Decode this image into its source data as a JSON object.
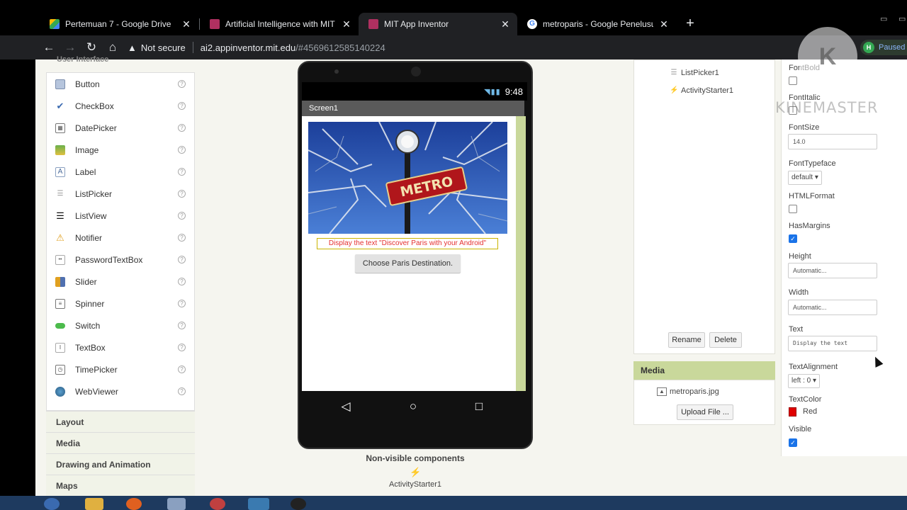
{
  "browser": {
    "tabs": [
      {
        "title": "Pertemuan 7 - Google Drive",
        "icon": "google-drive-icon",
        "active": false
      },
      {
        "title": "Artificial Intelligence with MIT Ap",
        "icon": "mit-app-inventor-icon",
        "active": false
      },
      {
        "title": "MIT App Inventor",
        "icon": "mit-app-inventor-icon",
        "active": true
      },
      {
        "title": "metroparis - Google Penelusuran",
        "icon": "google-icon",
        "active": false
      }
    ],
    "security_label": "Not secure",
    "url_host": "ai2.appinventor.mit.edu",
    "url_path": "/#4569612585140224",
    "profile_initial": "H",
    "profile_status": "Paused"
  },
  "palette": {
    "section_title": "User Interface",
    "items": [
      {
        "label": "Button",
        "icon": "button-icon"
      },
      {
        "label": "CheckBox",
        "icon": "checkbox-icon"
      },
      {
        "label": "DatePicker",
        "icon": "datepicker-icon"
      },
      {
        "label": "Image",
        "icon": "image-icon"
      },
      {
        "label": "Label",
        "icon": "label-icon"
      },
      {
        "label": "ListPicker",
        "icon": "listpicker-icon"
      },
      {
        "label": "ListView",
        "icon": "listview-icon"
      },
      {
        "label": "Notifier",
        "icon": "notifier-icon"
      },
      {
        "label": "PasswordTextBox",
        "icon": "password-icon"
      },
      {
        "label": "Slider",
        "icon": "slider-icon"
      },
      {
        "label": "Spinner",
        "icon": "spinner-icon"
      },
      {
        "label": "Switch",
        "icon": "switch-icon"
      },
      {
        "label": "TextBox",
        "icon": "textbox-icon"
      },
      {
        "label": "TimePicker",
        "icon": "timepicker-icon"
      },
      {
        "label": "WebViewer",
        "icon": "webviewer-icon"
      }
    ],
    "help_glyph": "?",
    "categories": [
      "Layout",
      "Media",
      "Drawing and Animation",
      "Maps"
    ]
  },
  "viewer": {
    "time": "9:48",
    "screen_title": "Screen1",
    "image_text": "METRO",
    "label_text": "Display the text \"Discover Paris with your Android\"",
    "button_text": "Choose Paris Destination.",
    "nonvisible_title": "Non-visible components",
    "nonvisible_item": "ActivityStarter1"
  },
  "components": {
    "items": [
      "ListPicker1",
      "ActivityStarter1"
    ],
    "rename_label": "Rename",
    "delete_label": "Delete"
  },
  "media": {
    "title": "Media",
    "file": "metroparis.jpg",
    "upload_label": "Upload File ..."
  },
  "properties": {
    "fontbold_label": "FontBold",
    "fontitalic_label": "FontItalic",
    "fontsize_label": "FontSize",
    "fontsize_value": "14.0",
    "fonttypeface_label": "FontTypeface",
    "fonttypeface_value": "default",
    "htmlformat_label": "HTMLFormat",
    "hasmargins_label": "HasMargins",
    "height_label": "Height",
    "height_value": "Automatic...",
    "width_label": "Width",
    "width_value": "Automatic...",
    "text_label": "Text",
    "text_value": "Display the text",
    "textalignment_label": "TextAlignment",
    "textalignment_value": "left : 0",
    "textcolor_label": "TextColor",
    "textcolor_value": "Red",
    "textcolor_hex": "#e00000",
    "visible_label": "Visible"
  },
  "overlay": {
    "watermark": "KINEMASTER",
    "watermark_logo": "K"
  }
}
